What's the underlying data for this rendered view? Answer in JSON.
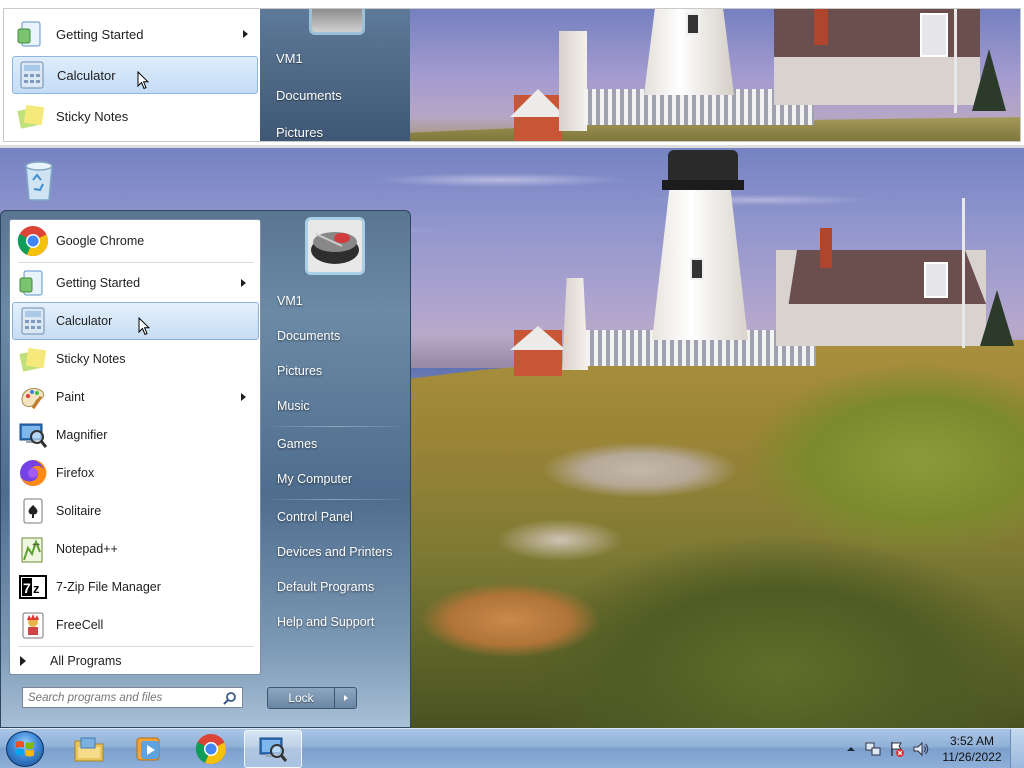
{
  "magnifier": {
    "left_items": [
      {
        "label": "Getting Started",
        "submenu": true,
        "selected": false
      },
      {
        "label": "Calculator",
        "submenu": false,
        "selected": true
      },
      {
        "label": "Sticky Notes",
        "submenu": false,
        "selected": false
      }
    ],
    "right_items": [
      "VM1",
      "Documents",
      "Pictures"
    ]
  },
  "start_menu": {
    "pinned": [
      {
        "label": "Google Chrome",
        "icon": "chrome-icon"
      }
    ],
    "programs": [
      {
        "label": "Getting Started",
        "icon": "getting-started-icon",
        "submenu": true,
        "selected": false
      },
      {
        "label": "Calculator",
        "icon": "calculator-icon",
        "submenu": false,
        "selected": true
      },
      {
        "label": "Sticky Notes",
        "icon": "sticky-notes-icon",
        "submenu": false,
        "selected": false
      },
      {
        "label": "Paint",
        "icon": "paint-icon",
        "submenu": true,
        "selected": false
      },
      {
        "label": "Magnifier",
        "icon": "magnifier-icon",
        "submenu": false,
        "selected": false
      },
      {
        "label": "Firefox",
        "icon": "firefox-icon",
        "submenu": false,
        "selected": false
      },
      {
        "label": "Solitaire",
        "icon": "solitaire-icon",
        "submenu": false,
        "selected": false
      },
      {
        "label": "Notepad++",
        "icon": "notepadpp-icon",
        "submenu": false,
        "selected": false
      },
      {
        "label": "7-Zip File Manager",
        "icon": "7zip-icon",
        "submenu": false,
        "selected": false
      },
      {
        "label": "FreeCell",
        "icon": "freecell-icon",
        "submenu": false,
        "selected": false
      }
    ],
    "all_programs_label": "All Programs",
    "search_placeholder": "Search programs and files",
    "right_items": {
      "user": "VM1",
      "documents": "Documents",
      "pictures": "Pictures",
      "music": "Music",
      "games": "Games",
      "computer": "My Computer",
      "control_panel": "Control Panel",
      "devices": "Devices and Printers",
      "default_programs": "Default Programs",
      "help": "Help and Support"
    },
    "shutdown_label": "Lock"
  },
  "taskbar": {
    "pinned": [
      "explorer-icon",
      "media-player-icon",
      "chrome-icon",
      "magnifier-icon"
    ],
    "active": "magnifier-icon",
    "clock_time": "3:52 AM",
    "clock_date": "11/26/2022"
  }
}
